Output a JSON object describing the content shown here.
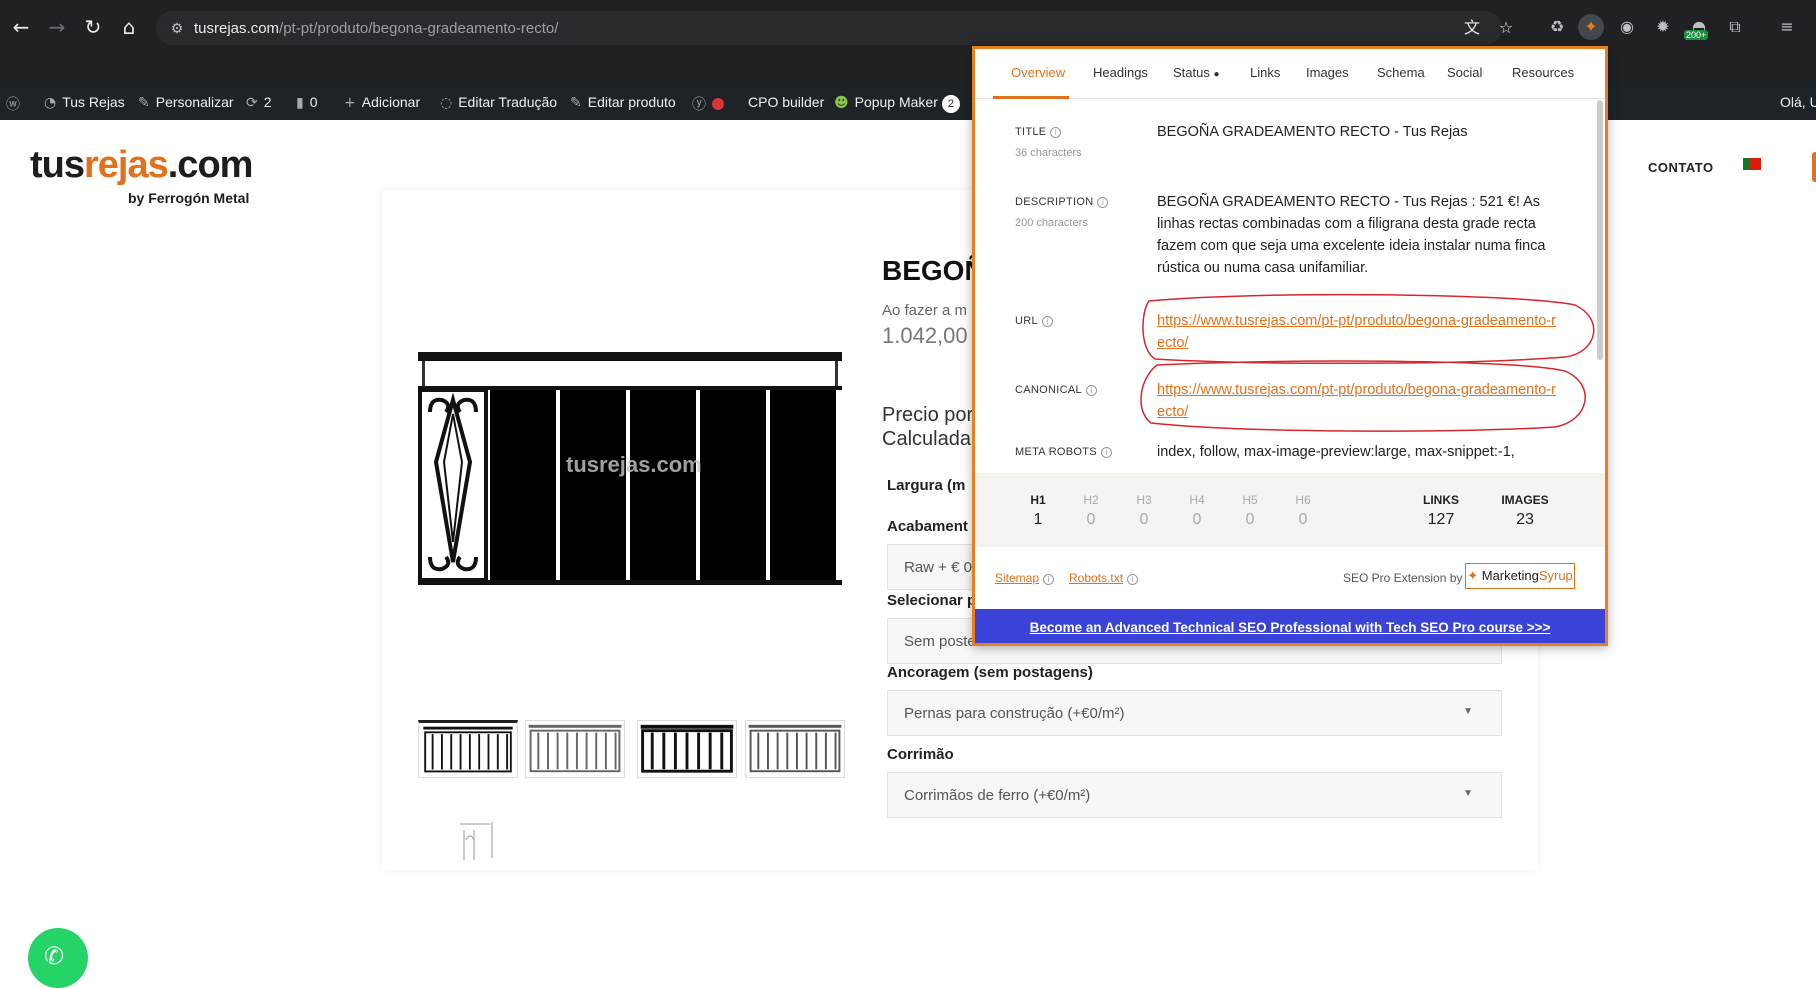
{
  "browser": {
    "url_host": "tusrejas.com",
    "url_path": "/pt-pt/produto/begona-gradeamento-recto/",
    "extensions_badge": "200+"
  },
  "wp_admin_bar": {
    "site_name": "Tus Rejas",
    "customize": "Personalizar",
    "updates_count": "2",
    "comments_count": "0",
    "add_new": "Adicionar",
    "edit_translation": "Editar Tradução",
    "edit_product": "Editar produto",
    "cpo_builder": "CPO builder",
    "popup_maker": "Popup Maker",
    "popup_maker_count": "2",
    "greeting": "Olá, U"
  },
  "site": {
    "logo_main": "tus",
    "logo_accent": "rejas",
    "logo_suffix": ".com",
    "logo_by": "by Ferrogón Metal",
    "menu_partial": "O",
    "menu_contact": "CONTATO",
    "watermark": "tusrejas.com",
    "product_title": "BEGOÑ",
    "product_subtitle": "Ao fazer a m",
    "product_price": "1.042,00 €",
    "calc_line1": "Precio por",
    "calc_line2": "Calculada",
    "field_width_label": "Largura (m",
    "field_finish_label": "Acabament",
    "field_finish_value": "Raw + € 0",
    "field_posts_label": "Selecionar p",
    "field_posts_value": "Sem poste",
    "field_anchor_label": "Ancoragem (sem postagens)",
    "field_anchor_value": "Pernas para construção (+€0/m²)",
    "field_handrail_label": "Corrimão",
    "field_handrail_value": "Corrimãos de ferro (+€0/m²)"
  },
  "seo_popup": {
    "tabs": [
      "Overview",
      "Headings",
      "Status",
      "Links",
      "Images",
      "Schema",
      "Social",
      "Resources"
    ],
    "title_label": "TITLE",
    "title_chars": "36 characters",
    "title_value": "BEGOÑA GRADEAMENTO RECTO - Tus Rejas",
    "description_label": "DESCRIPTION",
    "description_chars": "200 characters",
    "description_value": "BEGOÑA GRADEAMENTO RECTO - Tus Rejas : 521 €! As linhas rectas combinadas com a filigrana desta grade recta fazem com que seja uma excelente ideia instalar numa finca rústica ou numa casa unifamiliar.",
    "url_label": "URL",
    "url_value": "https://www.tusrejas.com/pt-pt/produto/begona-gradeamento-recto/",
    "canonical_label": "CANONICAL",
    "canonical_value": "https://www.tusrejas.com/pt-pt/produto/begona-gradeamento-recto/",
    "meta_robots_label": "META ROBOTS",
    "meta_robots_value": "index, follow, max-image-preview:large, max-snippet:-1,",
    "headings": [
      {
        "label": "H1",
        "value": "1"
      },
      {
        "label": "H2",
        "value": "0"
      },
      {
        "label": "H3",
        "value": "0"
      },
      {
        "label": "H4",
        "value": "0"
      },
      {
        "label": "H5",
        "value": "0"
      },
      {
        "label": "H6",
        "value": "0"
      }
    ],
    "links_label": "LINKS",
    "links_value": "127",
    "images_label": "IMAGES",
    "images_value": "23",
    "sitemap": "Sitemap",
    "robots": "Robots.txt",
    "powered_by": "SEO Pro Extension by",
    "brand_a": "Marketing",
    "brand_b": "Syrup",
    "banner": "Become an Advanced Technical SEO Professional with Tech SEO Pro course >>>"
  },
  "colors": {
    "accent": "#e2711d",
    "banner": "#3b42d8",
    "annotation": "#d8262c"
  }
}
